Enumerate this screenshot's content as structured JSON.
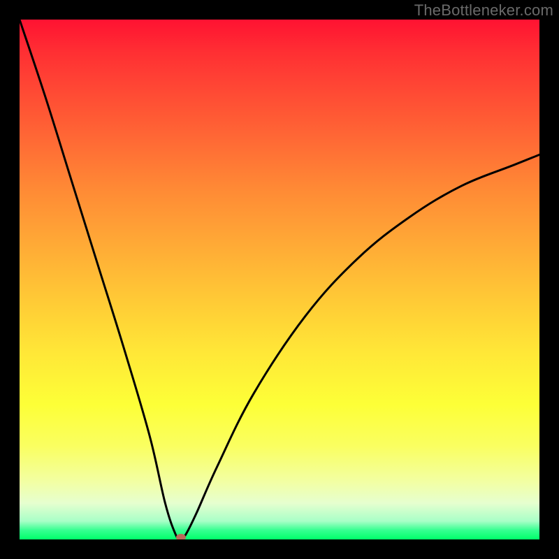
{
  "watermark": "TheBottleneker.com",
  "chart_data": {
    "type": "line",
    "title": "",
    "xlabel": "",
    "ylabel": "",
    "xlim": [
      0,
      100
    ],
    "ylim": [
      0,
      100
    ],
    "x_is_component_scale": true,
    "y_is_bottleneck_percent": true,
    "series": [
      {
        "name": "bottleneck-curve",
        "x": [
          0,
          5,
          10,
          15,
          20,
          25,
          28,
          30,
          31,
          32,
          34,
          38,
          45,
          55,
          65,
          75,
          85,
          95,
          100
        ],
        "values": [
          100,
          85,
          69,
          53,
          37,
          20,
          7,
          1,
          0,
          1,
          5,
          14,
          28,
          43,
          54,
          62,
          68,
          72,
          74
        ]
      }
    ],
    "marker": {
      "x": 31,
      "y": 0,
      "name": "current-config-dot"
    },
    "gradient_meaning": "red=high bottleneck, green=low bottleneck"
  },
  "colors": {
    "frame": "#000000",
    "curve": "#000000",
    "dot": "#b96a5a",
    "watermark": "#6a6a6a"
  }
}
